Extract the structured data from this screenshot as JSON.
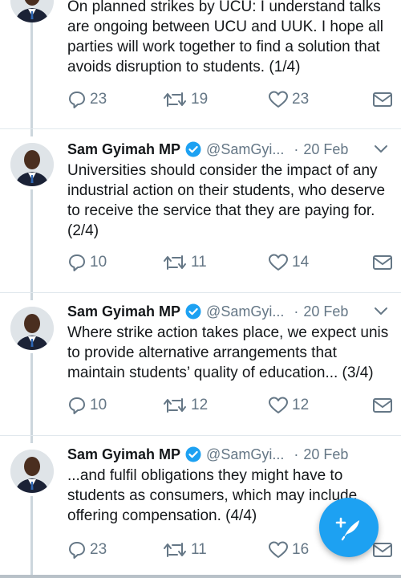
{
  "author": {
    "name": "Sam Gyimah MP",
    "handle": "@SamGyi...",
    "verified": true
  },
  "tweets": [
    {
      "date": "",
      "text": "On planned strikes by UCU: I understand talks are ongoing between UCU and UUK. I hope all parties will work together to find a solution that avoids disruption to students. (1/4)",
      "replies": "23",
      "retweets": "19",
      "likes": "23"
    },
    {
      "date": "20 Feb",
      "text": "Universities should consider the impact of any industrial action on their students, who deserve to receive the service that they are paying for. (2/4)",
      "replies": "10",
      "retweets": "11",
      "likes": "14"
    },
    {
      "date": "20 Feb",
      "text": "Where strike action takes place, we expect unis to provide alternative arrangements that maintain students’ quality of education... (3/4)",
      "replies": "10",
      "retweets": "12",
      "likes": "12"
    },
    {
      "date": "20 Feb",
      "text": "...and fulfil obligations they might have to students as consumers, which may include offering compensation. (4/4)",
      "replies": "23",
      "retweets": "11",
      "likes": "16"
    }
  ],
  "separator": "·",
  "icons": {
    "reply": "reply-icon",
    "retweet": "retweet-icon",
    "like": "heart-icon",
    "dm": "direct-message-icon",
    "menu": "chevron-down-icon",
    "verified": "verified-badge-icon",
    "compose": "compose-tweet-icon"
  },
  "colors": {
    "accent": "#1da1f2",
    "text": "#14171a",
    "secondary": "#657786",
    "thread_line": "#ccd6dd"
  }
}
